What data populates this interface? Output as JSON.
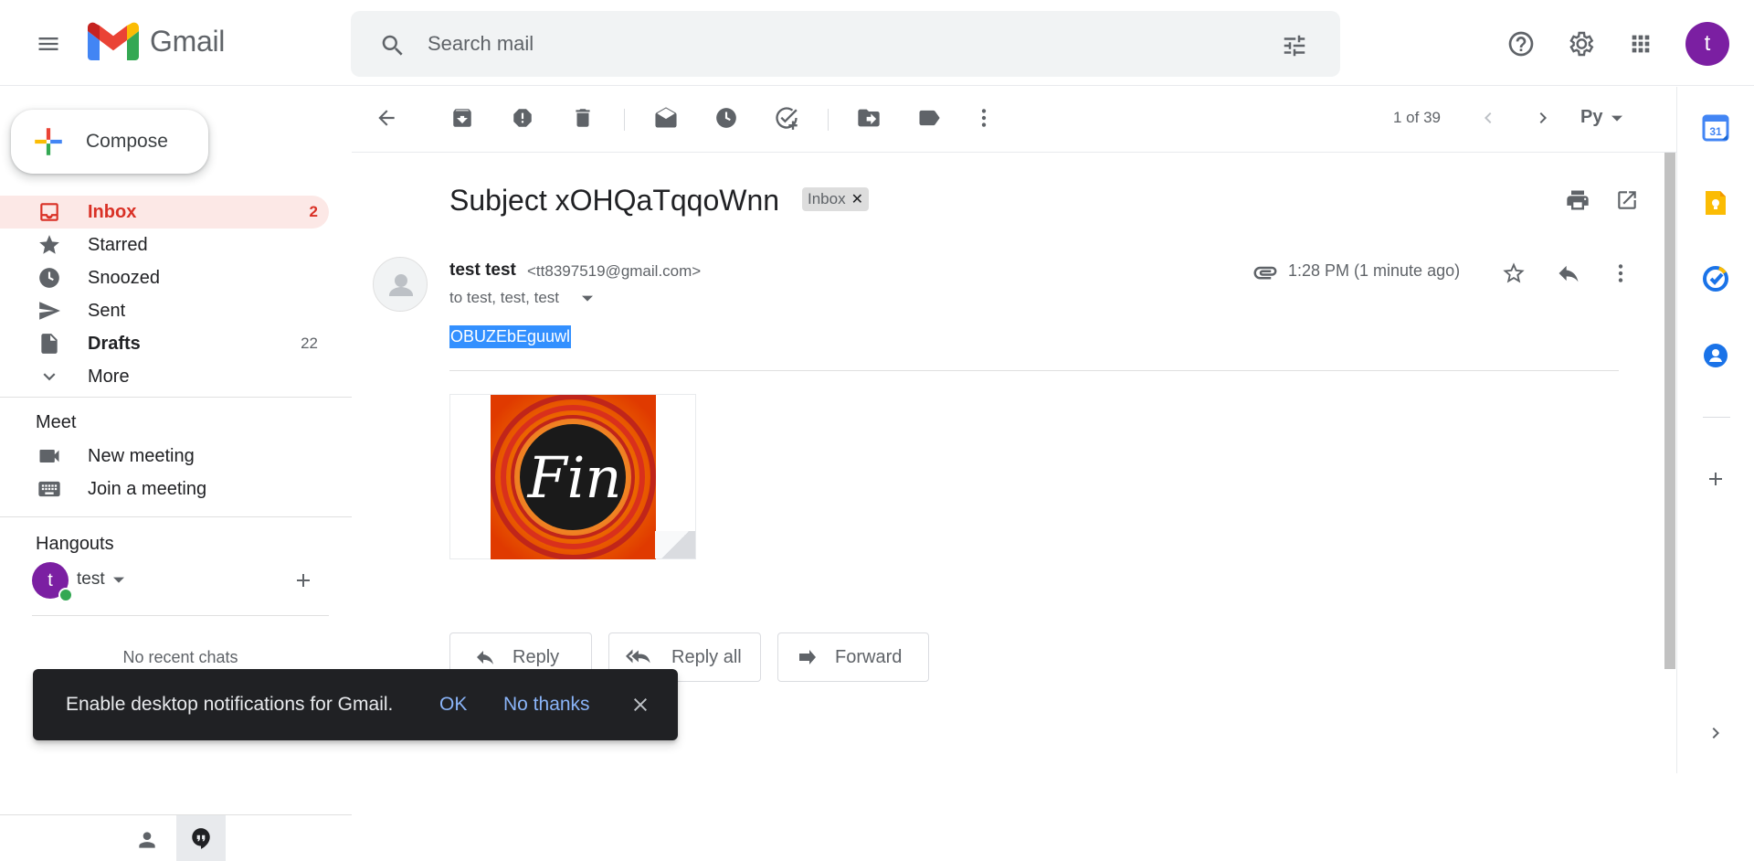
{
  "header": {
    "app_name": "Gmail",
    "search_placeholder": "Search mail",
    "account_initial": "t"
  },
  "sidebar": {
    "compose_label": "Compose",
    "items": [
      {
        "label": "Inbox",
        "count": "2",
        "icon": "inbox-icon"
      },
      {
        "label": "Starred",
        "count": "",
        "icon": "star-icon"
      },
      {
        "label": "Snoozed",
        "count": "",
        "icon": "clock-icon"
      },
      {
        "label": "Sent",
        "count": "",
        "icon": "send-icon"
      },
      {
        "label": "Drafts",
        "count": "22",
        "icon": "draft-icon"
      },
      {
        "label": "More",
        "count": "",
        "icon": "chevron-down-icon"
      }
    ],
    "meet": {
      "title": "Meet",
      "new_meeting": "New meeting",
      "join_meeting": "Join a meeting"
    },
    "hangouts": {
      "title": "Hangouts",
      "user_initial": "t",
      "user_name": "test",
      "no_chats": "No recent chats"
    }
  },
  "toolbar": {
    "pager": "1 of 39",
    "lang": "Ру"
  },
  "email": {
    "subject": "Subject xOHQaTqqoWnn",
    "label": "Inbox",
    "sender_name": "test test",
    "sender_email": "<tt8397519@gmail.com>",
    "recipients": "to test, test, test",
    "time": "1:28 PM (1 minute ago)",
    "body": "OBUZEbEguuwl",
    "attachment_text": "Fin"
  },
  "actions": {
    "reply": "Reply",
    "reply_all": "Reply all",
    "forward": "Forward"
  },
  "snackbar": {
    "message": "Enable desktop notifications for Gmail.",
    "ok": "OK",
    "no_thanks": "No thanks"
  },
  "right_panel": {
    "calendar_day": "31"
  },
  "colors": {
    "accent_red": "#d93025",
    "active_bg": "#fce8e6",
    "avatar_purple": "#7b1fa2",
    "link_blue": "#8ab4f8",
    "selection_blue": "#3390ff"
  }
}
